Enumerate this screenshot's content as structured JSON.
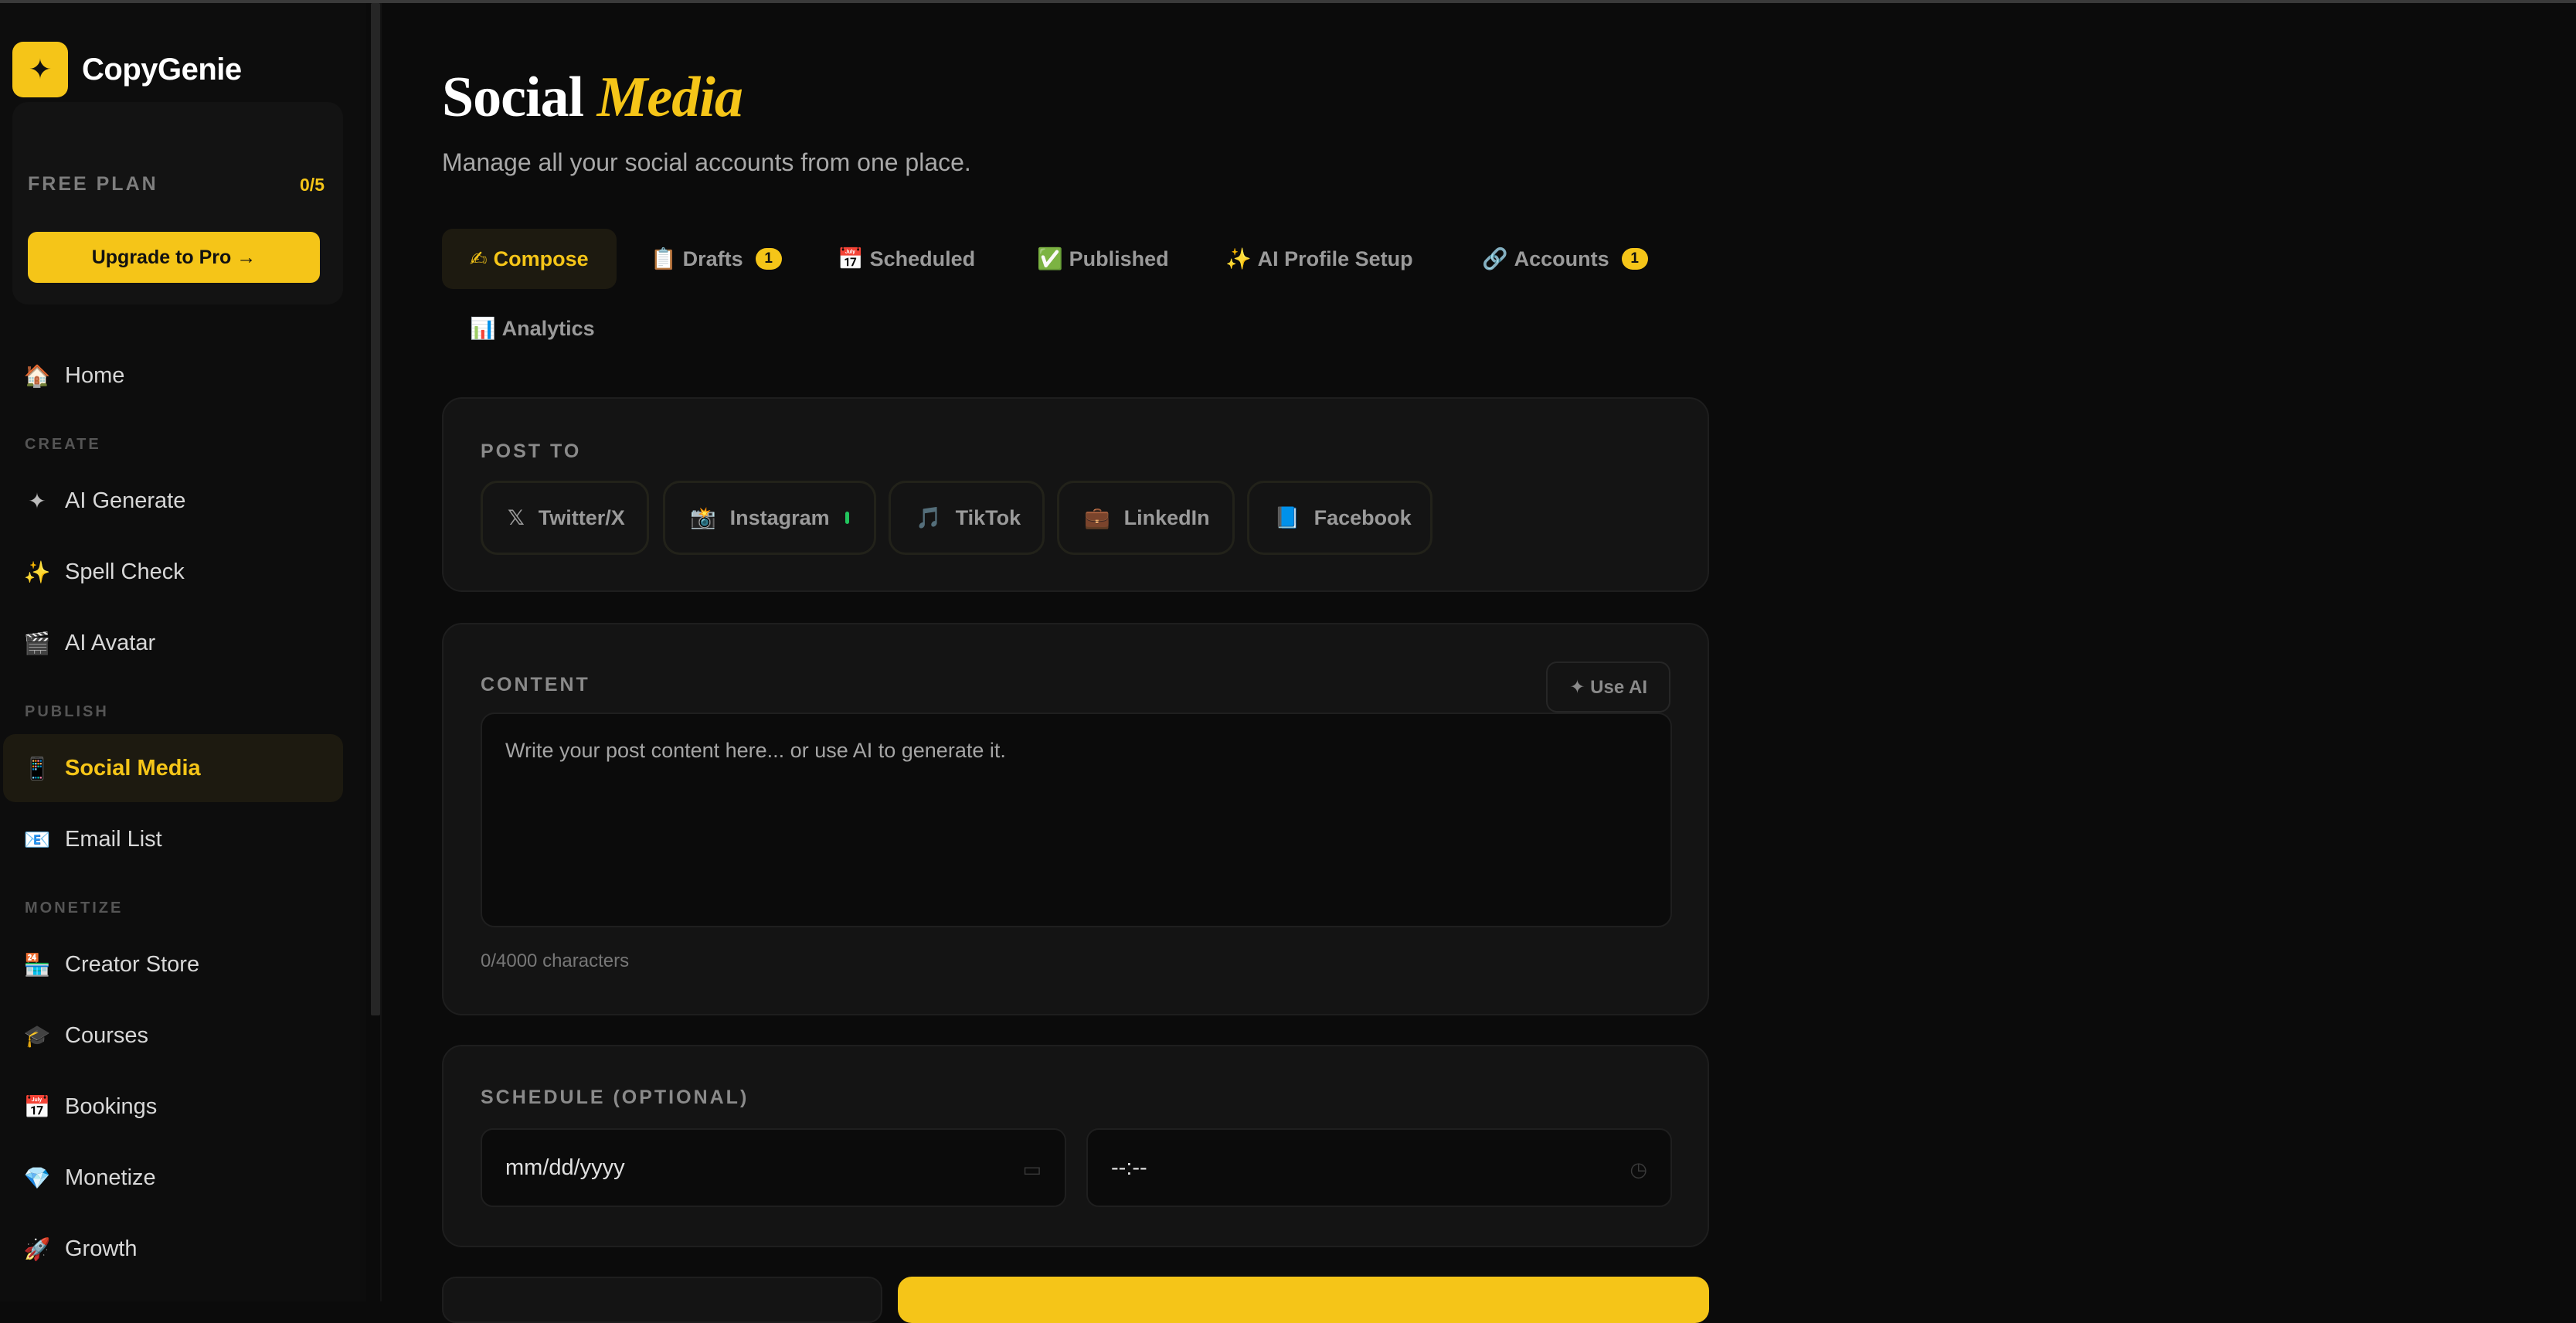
{
  "brand": {
    "name": "CopyGenie",
    "logo_glyph": "✦",
    "accent": "#f5c518"
  },
  "plan": {
    "label": "FREE PLAN",
    "count": "0/5",
    "upgrade_label": "Upgrade to Pro →"
  },
  "nav": {
    "home": {
      "icon": "🏠",
      "label": "Home"
    },
    "sections": {
      "create": "CREATE",
      "publish": "PUBLISH",
      "monetize": "MONETIZE"
    },
    "create": [
      {
        "icon": "✦",
        "label": "AI Generate"
      },
      {
        "icon": "✨",
        "label": "Spell Check"
      },
      {
        "icon": "🎬",
        "label": "AI Avatar"
      }
    ],
    "publish": [
      {
        "icon": "📱",
        "label": "Social Media",
        "active": true
      },
      {
        "icon": "📧",
        "label": "Email List"
      }
    ],
    "monetize": [
      {
        "icon": "🏪",
        "label": "Creator Store"
      },
      {
        "icon": "🎓",
        "label": "Courses"
      },
      {
        "icon": "📅",
        "label": "Bookings"
      },
      {
        "icon": "💎",
        "label": "Monetize"
      },
      {
        "icon": "🚀",
        "label": "Growth"
      }
    ]
  },
  "page": {
    "title_main": "Social",
    "title_accent": "Media",
    "subtitle": "Manage all your social accounts from one place."
  },
  "tabs": [
    {
      "icon": "✍",
      "label": "Compose",
      "active": true
    },
    {
      "icon": "📋",
      "label": "Drafts",
      "badge": "1"
    },
    {
      "icon": "📅",
      "label": "Scheduled"
    },
    {
      "icon": "✅",
      "label": "Published"
    },
    {
      "icon": "✨",
      "label": "AI Profile Setup"
    },
    {
      "icon": "🔗",
      "label": "Accounts",
      "badge": "1"
    },
    {
      "icon": "📊",
      "label": "Analytics"
    }
  ],
  "post_to": {
    "label": "POST TO",
    "platforms": [
      {
        "icon": "𝕏",
        "label": "Twitter/X"
      },
      {
        "icon": "📸",
        "label": "Instagram",
        "connected": true,
        "status_color": "#22c55e"
      },
      {
        "icon": "🎵",
        "label": "TikTok"
      },
      {
        "icon": "💼",
        "label": "LinkedIn"
      },
      {
        "icon": "📘",
        "label": "Facebook"
      }
    ]
  },
  "content": {
    "label": "CONTENT",
    "use_ai_label": "✦ Use AI",
    "placeholder": "Write your post content here... or use AI to generate it.",
    "char_count": "0/4000 characters"
  },
  "schedule": {
    "label": "SCHEDULE (OPTIONAL)",
    "date_placeholder": "mm/dd/yyyy",
    "time_placeholder": "--:--",
    "date_icon": "calendar-icon",
    "time_icon": "clock-icon"
  }
}
